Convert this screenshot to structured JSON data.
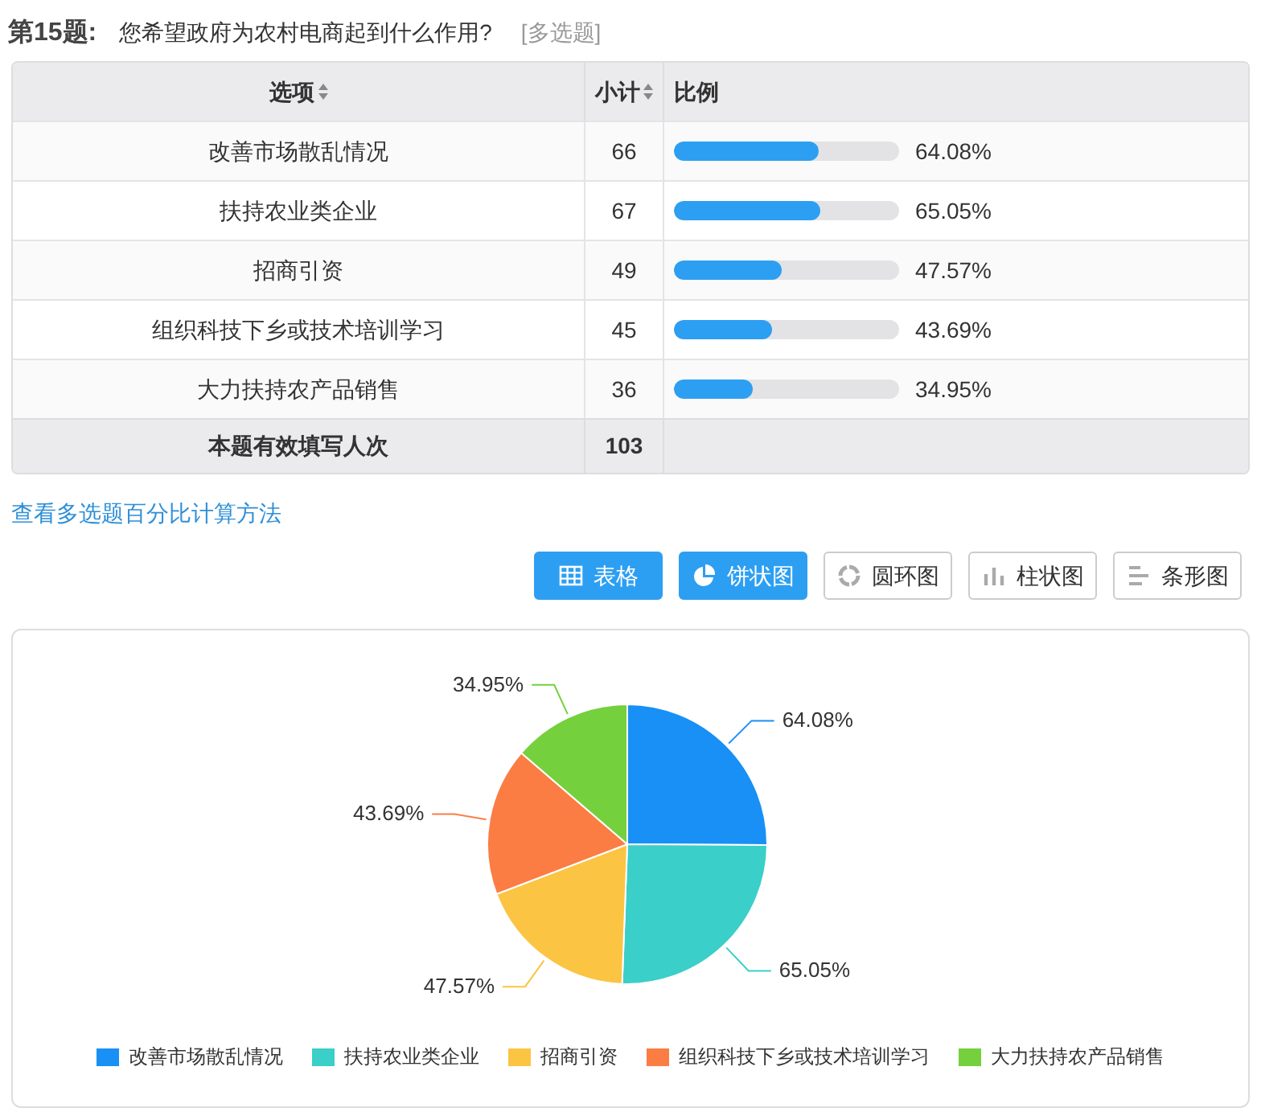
{
  "question": {
    "number": "第15题:",
    "text": "您希望政府为农村电商起到什么作用?",
    "type": "[多选题]"
  },
  "table": {
    "columns": [
      "选项",
      "小计",
      "比例"
    ],
    "rows": [
      {
        "option": "改善市场散乱情况",
        "count": "66",
        "level": 0.6408,
        "percent": "64.08%"
      },
      {
        "option": "扶持农业类企业",
        "count": "67",
        "level": 0.6505,
        "percent": "65.05%"
      },
      {
        "option": "招商引资",
        "count": "49",
        "level": 0.4757,
        "percent": "47.57%"
      },
      {
        "option": "组织科技下乡或技术培训学习",
        "count": "45",
        "level": 0.4369,
        "percent": "43.69%"
      },
      {
        "option": "大力扶持农产品销售",
        "count": "36",
        "level": 0.3495,
        "percent": "34.95%"
      }
    ],
    "total": {
      "label": "本题有效填写人次",
      "count": "103"
    }
  },
  "link": "查看多选题百分比计算方法",
  "view_buttons": [
    {
      "kind": "table",
      "label": "表格",
      "selected": true
    },
    {
      "kind": "pie",
      "label": "饼状图",
      "selected": true
    },
    {
      "kind": "ring",
      "label": "圆环图",
      "selected": false
    },
    {
      "kind": "column",
      "label": "柱状图",
      "selected": false
    },
    {
      "kind": "bar",
      "label": "条形图",
      "selected": false
    }
  ],
  "chart": {
    "chart_data": {
      "type": "pie",
      "categories": [
        "改善市场散乱情况",
        "扶持农业类企业",
        "招商引资",
        "组织科技下乡或技术培训学习",
        "大力扶持农产品销售"
      ],
      "series": [
        {
          "values": [
            25.1,
            25.48,
            18.63,
            17.11,
            13.68
          ]
        }
      ],
      "legend": "bottom",
      "colors": [
        "#1890f5",
        "#3acfc8",
        "#fcc443",
        "#fb7d44",
        "#75d03d"
      ],
      "value_labels": [
        "64.08%",
        "65.05%",
        "47.57%",
        "43.69%",
        "34.95%"
      ]
    }
  }
}
